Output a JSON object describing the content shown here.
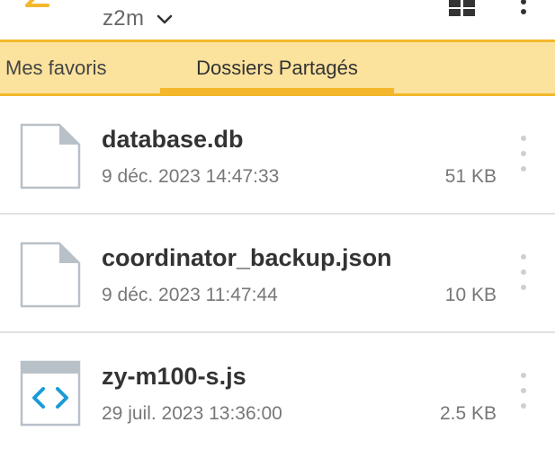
{
  "app_bar": {
    "folder_title": "z2m",
    "icons": {
      "back": "back-arrow-icon",
      "chevron": "chevron-down-icon",
      "grid_view": "grid-view-icon",
      "overflow": "more-vertical-icon"
    },
    "accent_color": "#f3b72c"
  },
  "tabs": [
    {
      "label": "Mes favoris",
      "active": false
    },
    {
      "label": "Dossiers Partagés",
      "active": true
    }
  ],
  "tab_bar_color": "#fbe29d",
  "files": [
    {
      "name": "database.db",
      "date": "9 déc. 2023 14:47:33",
      "size": "51 KB",
      "icon": "blank-file-icon"
    },
    {
      "name": "coordinator_backup.json",
      "date": "9 déc. 2023 11:47:44",
      "size": "10 KB",
      "icon": "blank-file-icon"
    },
    {
      "name": "zy-m100-s.js",
      "date": "29 juil. 2023 13:36:00",
      "size": "2.5 KB",
      "icon": "code-file-icon"
    }
  ]
}
